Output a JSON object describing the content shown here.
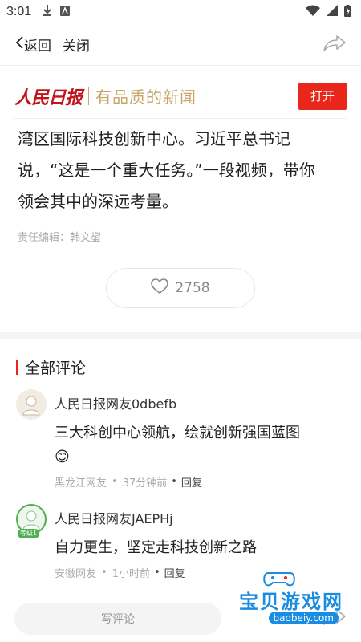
{
  "status": {
    "time": "3:01"
  },
  "nav": {
    "back_label": "返回",
    "close_label": "关闭"
  },
  "banner": {
    "logo": "人民日报",
    "slogan": "有品质的新闻",
    "open_label": "打开"
  },
  "article": {
    "lines": [
      "湾区国际科技创新中心。习近平总书记",
      "说，“这是一个重大任务。”一段视频，带你",
      "领会其中的深远考量。"
    ],
    "editor": "责任编辑：韩文鋆"
  },
  "likes": {
    "count": "2758"
  },
  "comments": {
    "title": "全部评论",
    "items": [
      {
        "name": "人民日报网友0dbefb",
        "text": "三大科创中心领航，绘就创新强国蓝图",
        "emoji": "😊",
        "location": "黑龙江网友",
        "time": "37分钟前",
        "reply": "回复"
      },
      {
        "name": "人民日报网友JAEPHj",
        "text": "自力更生，坚定走科技创新之路",
        "location": "安徽网友",
        "time": "1小时前",
        "reply": "回复",
        "badge": "等级1"
      }
    ]
  },
  "bottom": {
    "write_placeholder": "写评论"
  },
  "watermark": {
    "text": "宝贝游戏网",
    "url": "baobeiy.com"
  },
  "colors": {
    "accent": "#e8261a",
    "logo": "#c0141a",
    "slogan": "#c9a56a"
  }
}
